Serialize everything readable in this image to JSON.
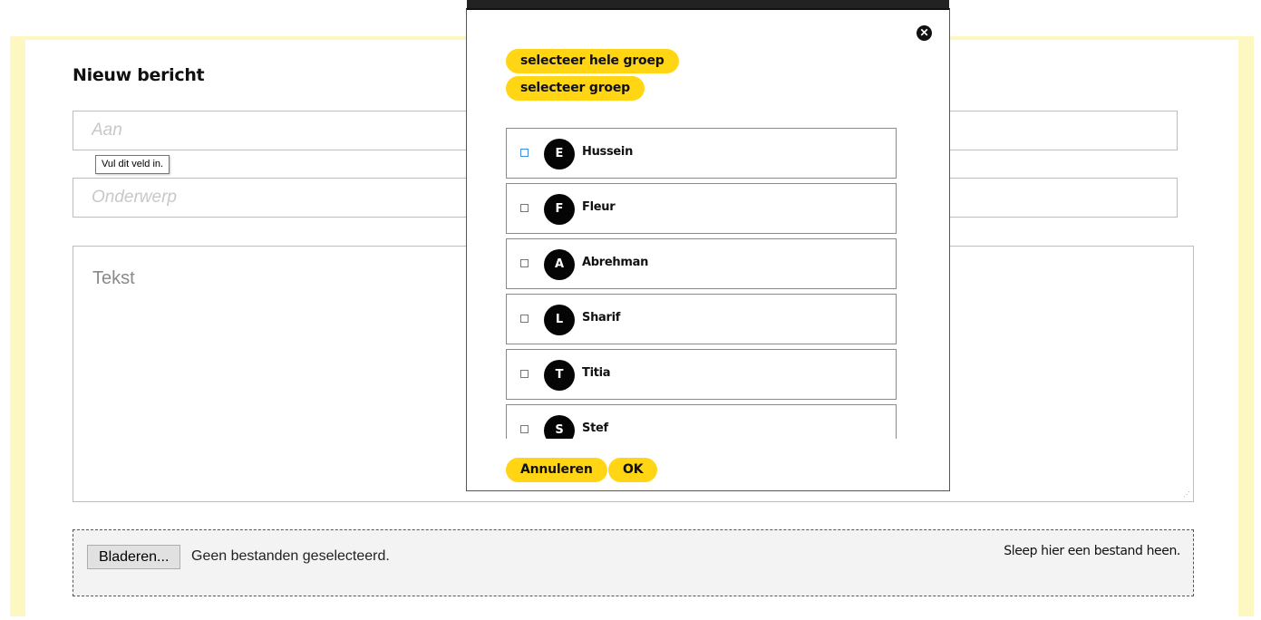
{
  "composer": {
    "heading": "Nieuw bericht",
    "to_placeholder": "Aan",
    "subject_placeholder": "Onderwerp",
    "body_placeholder": "Tekst",
    "validation_tooltip": "Vul dit veld in.",
    "browse_label": "Bladeren...",
    "no_files_text": "Geen bestanden geselecteerd.",
    "drop_hint": "Sleep hier een bestand heen."
  },
  "modal": {
    "close_icon": "close-circle-icon",
    "select_whole_group_label": "selecteer hele groep",
    "select_group_label": "selecteer groep",
    "cancel_label": "Annuleren",
    "ok_label": "OK",
    "users": [
      {
        "initial": "E",
        "name": "Hussein",
        "checked": false
      },
      {
        "initial": "F",
        "name": "Fleur",
        "checked": false
      },
      {
        "initial": "A",
        "name": "Abrehman",
        "checked": false
      },
      {
        "initial": "L",
        "name": "Sharif",
        "checked": false
      },
      {
        "initial": "T",
        "name": "Titia",
        "checked": false
      },
      {
        "initial": "S",
        "name": "Stef",
        "checked": false
      }
    ]
  },
  "colors": {
    "accent": "#ffd514",
    "frame": "#fdf7c1",
    "avatar": "#050505"
  }
}
